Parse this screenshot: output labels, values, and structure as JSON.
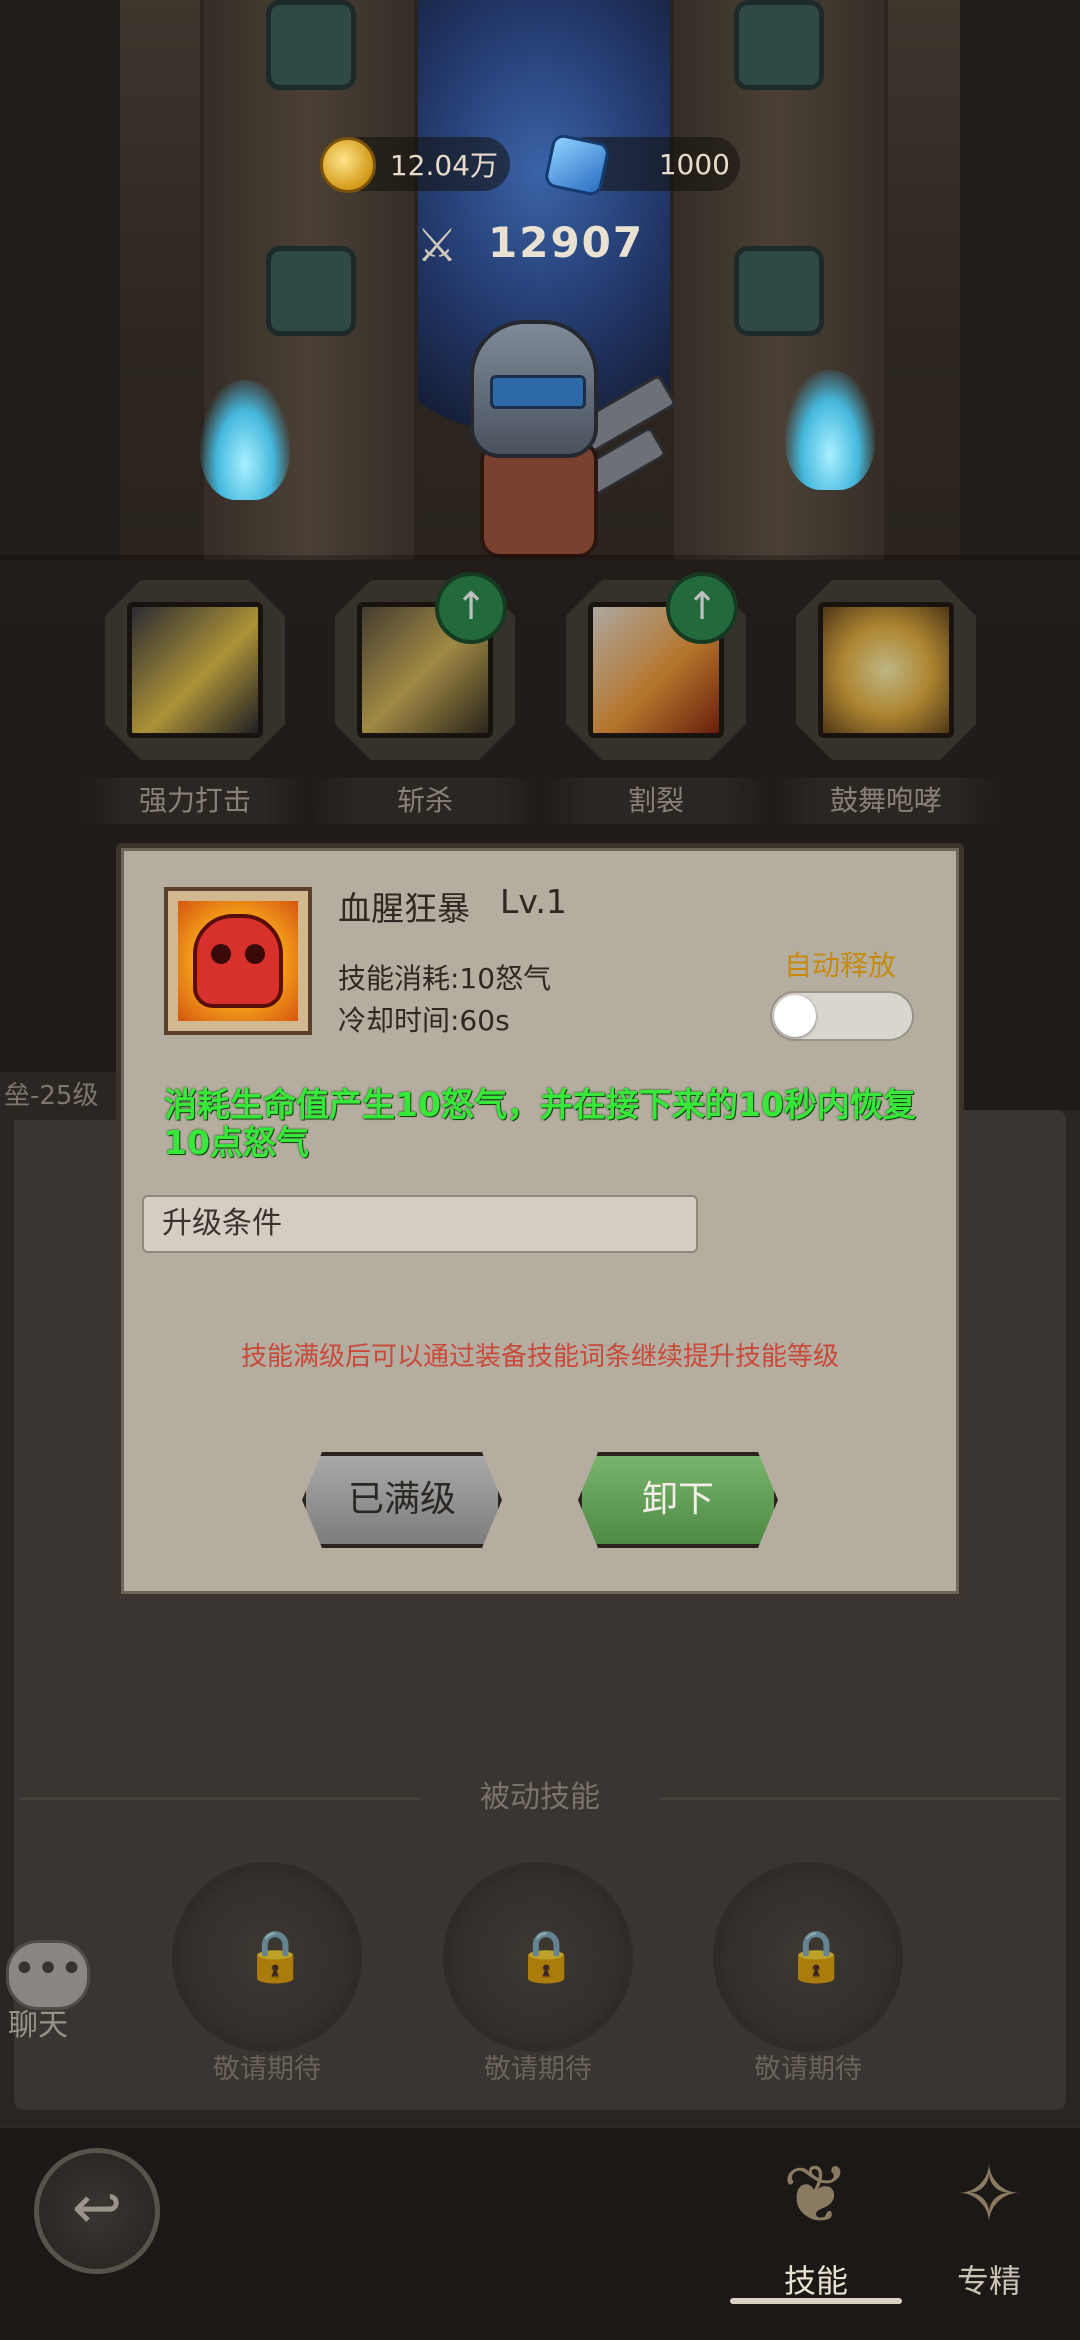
{
  "hud": {
    "gold": "12.04万",
    "gems": "1000",
    "power": "12907"
  },
  "skills": [
    {
      "name": "强力打击",
      "upgradable": false,
      "icon": "blade-strike-icon",
      "color": "#e6c34a"
    },
    {
      "name": "斩杀",
      "upgradable": true,
      "icon": "axe-slash-icon",
      "color": "#d7b85a"
    },
    {
      "name": "割裂",
      "upgradable": true,
      "icon": "rend-claw-icon",
      "color": "#f29d3b"
    },
    {
      "name": "鼓舞咆哮",
      "upgradable": false,
      "icon": "roar-face-icon",
      "color": "#e7b241"
    }
  ],
  "left_tab_label": "垒-25级",
  "dialog": {
    "skill_name": "血腥狂暴",
    "level": "Lv.1",
    "cost": "技能消耗:10怒气",
    "cooldown": "冷却时间:60s",
    "auto_release_label": "自动释放",
    "auto_release_on": false,
    "description": "消耗生命值产生10怒气，并在接下来的10秒内恢复10点怒气",
    "upgrade_condition_label": "升级条件",
    "hint": "技能满级后可以通过装备技能词条继续提升技能等级",
    "max_level_button": "已满级",
    "unequip_button": "卸下"
  },
  "passive": {
    "title": "被动技能",
    "slots": [
      "敬请期待",
      "敬请期待",
      "敬请期待"
    ]
  },
  "chat_label": "聊天",
  "footer": {
    "tabs": [
      {
        "label": "技能",
        "active": true
      },
      {
        "label": "专精",
        "active": false
      }
    ]
  },
  "colors": {
    "description": "#37e83a",
    "hint": "#c84a3b",
    "auto_label": "#c68b0e",
    "unequip_button": "#5a9a50"
  }
}
